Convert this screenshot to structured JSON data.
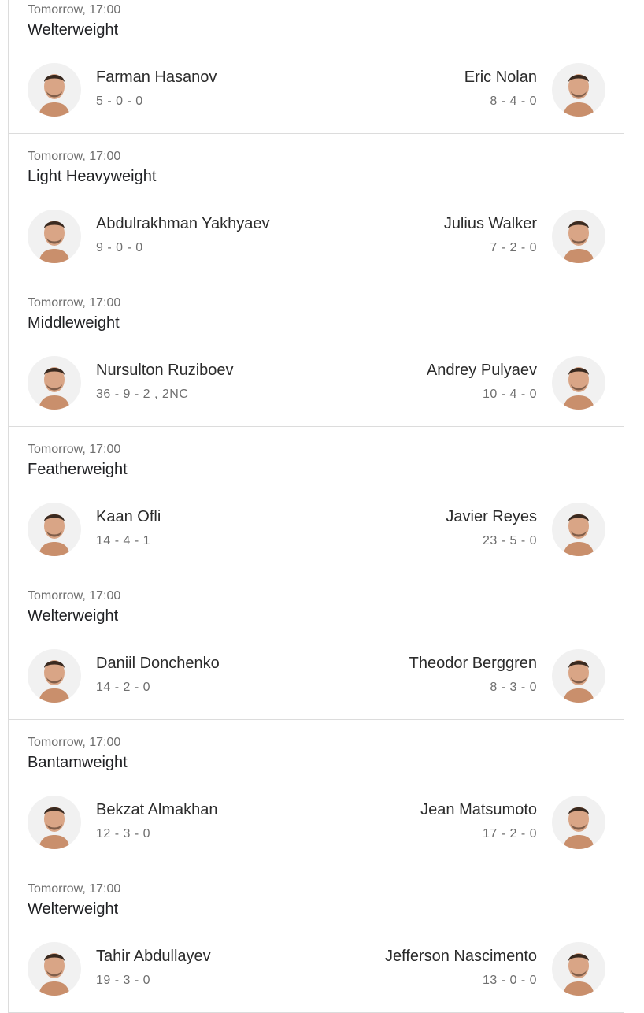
{
  "colors": {
    "text": "#202124",
    "secondary": "#6f6f6f",
    "divider": "#dcdcdc",
    "skin": "#d9a586"
  },
  "fights": [
    {
      "time": "Tomorrow, 17:00",
      "weight_class": "Welterweight",
      "fighter1": {
        "name": "Farman Hasanov",
        "record": "5 - 0 - 0",
        "avatar_icon": "fighter-headshot"
      },
      "fighter2": {
        "name": "Eric Nolan",
        "record": "8 - 4 - 0",
        "avatar_icon": "fighter-headshot"
      }
    },
    {
      "time": "Tomorrow, 17:00",
      "weight_class": "Light Heavyweight",
      "fighter1": {
        "name": "Abdulrakhman Yakhyaev",
        "record": "9 - 0 - 0",
        "avatar_icon": "fighter-headshot"
      },
      "fighter2": {
        "name": "Julius Walker",
        "record": "7 - 2 - 0",
        "avatar_icon": "fighter-headshot"
      }
    },
    {
      "time": "Tomorrow, 17:00",
      "weight_class": "Middleweight",
      "fighter1": {
        "name": "Nursulton Ruziboev",
        "record": "36 - 9 - 2 , 2NC",
        "avatar_icon": "fighter-headshot"
      },
      "fighter2": {
        "name": "Andrey Pulyaev",
        "record": "10 - 4 - 0",
        "avatar_icon": "fighter-headshot"
      }
    },
    {
      "time": "Tomorrow, 17:00",
      "weight_class": "Featherweight",
      "fighter1": {
        "name": "Kaan Ofli",
        "record": "14 - 4 - 1",
        "avatar_icon": "fighter-headshot"
      },
      "fighter2": {
        "name": "Javier Reyes",
        "record": "23 - 5 - 0",
        "avatar_icon": "fighter-headshot"
      }
    },
    {
      "time": "Tomorrow, 17:00",
      "weight_class": "Welterweight",
      "fighter1": {
        "name": "Daniil Donchenko",
        "record": "14 - 2 - 0",
        "avatar_icon": "fighter-headshot"
      },
      "fighter2": {
        "name": "Theodor Berggren",
        "record": "8 - 3 - 0",
        "avatar_icon": "fighter-headshot"
      }
    },
    {
      "time": "Tomorrow, 17:00",
      "weight_class": "Bantamweight",
      "fighter1": {
        "name": "Bekzat Almakhan",
        "record": "12 - 3 - 0",
        "avatar_icon": "fighter-headshot"
      },
      "fighter2": {
        "name": "Jean Matsumoto",
        "record": "17 - 2 - 0",
        "avatar_icon": "fighter-headshot"
      }
    },
    {
      "time": "Tomorrow, 17:00",
      "weight_class": "Welterweight",
      "fighter1": {
        "name": "Tahir Abdullayev",
        "record": "19 - 3 - 0",
        "avatar_icon": "fighter-headshot"
      },
      "fighter2": {
        "name": "Jefferson Nascimento",
        "record": "13 - 0 - 0",
        "avatar_icon": "fighter-headshot"
      }
    }
  ]
}
